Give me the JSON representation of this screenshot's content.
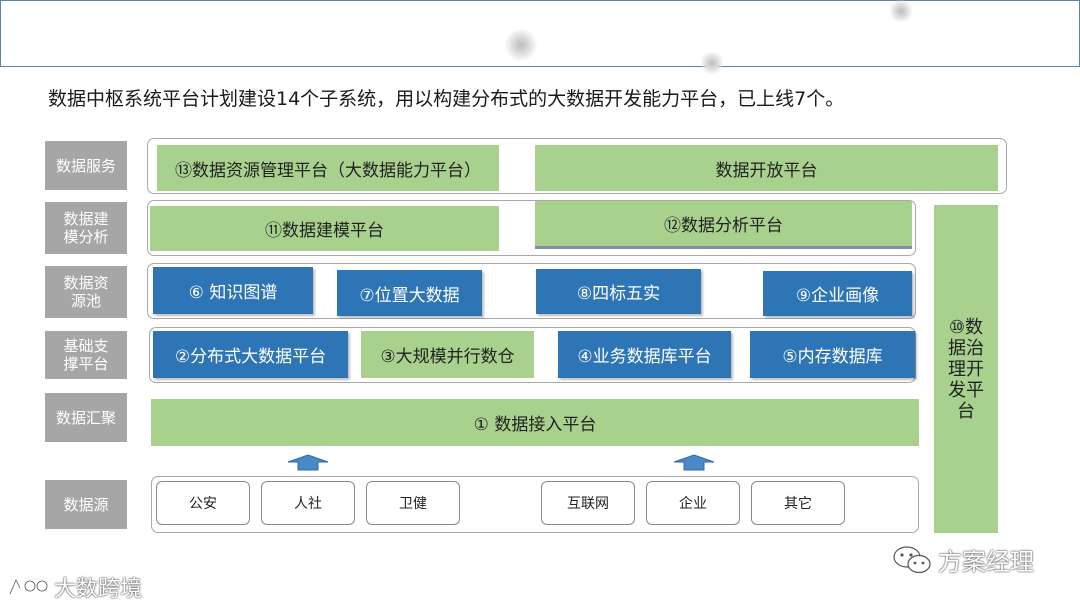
{
  "headline": "数据中枢系统平台计划建设14个子系统，用以构建分布式的大数据开发能力平台，已上线7个。",
  "rows": [
    {
      "label": "数据服务"
    },
    {
      "label": "数据建模分析"
    },
    {
      "label": "数据资源池"
    },
    {
      "label": "基础支撑平台"
    },
    {
      "label": "数据汇聚"
    },
    {
      "label": "数据源"
    }
  ],
  "service": {
    "items": [
      "⑬数据资源管理平台（大数据能力平台）",
      "数据开放平台"
    ]
  },
  "modeling": {
    "items": [
      "⑪数据建模平台",
      "⑫数据分析平台"
    ]
  },
  "resource_pool": {
    "items": [
      "⑥ 知识图谱",
      "⑦位置大数据",
      "⑧四标五实",
      "⑨企业画像"
    ]
  },
  "support": {
    "items": [
      "②分布式大数据平台",
      "③大规模并行数仓",
      "④业务数据库平台",
      "⑤内存数据库"
    ]
  },
  "aggregation": {
    "item": "① 数据接入平台"
  },
  "sources": {
    "items": [
      "公安",
      "人社",
      "卫健",
      "互联网",
      "企业",
      "其它"
    ]
  },
  "governance": {
    "label": "⑩数据治理开发平台"
  },
  "watermarks": {
    "left": "大数跨境",
    "right": "方案经理"
  },
  "colors": {
    "green": "#a9d18e",
    "blue": "#2e75b6",
    "label_gray": "#a6a6a6",
    "frame_border": "#5d83a8"
  },
  "icons": [
    "up-arrow-icon",
    "wechat-icon",
    "logo-icon"
  ]
}
